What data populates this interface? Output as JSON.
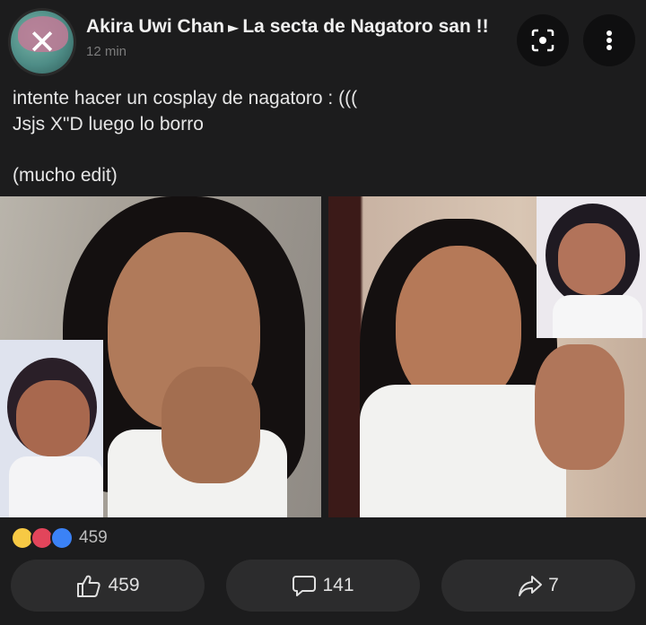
{
  "post": {
    "author": "Akira Uwi Chan",
    "separator_icon": "triangle-right-icon",
    "group": "La secta de Nagatoro san !!",
    "time": "12 min",
    "lines": [
      "intente hacer un cosplay de nagatoro : (((",
      "Jsjs X\"D luego lo borro",
      "(mucho edit)"
    ]
  },
  "header_buttons": {
    "lens": "lens-search-icon",
    "more": "more-dots-icon"
  },
  "reactions": {
    "icons": [
      "haha-emoji",
      "love-emoji",
      "like-emoji"
    ],
    "count": "459"
  },
  "actions": {
    "like_count": "459",
    "comment_count": "141",
    "share_count": "7"
  },
  "colors": {
    "background": "#1c1c1d",
    "button": "#2c2c2d",
    "like_blue": "#3b82f6",
    "love_red": "#e2455b",
    "haha_yellow": "#f7c944"
  }
}
